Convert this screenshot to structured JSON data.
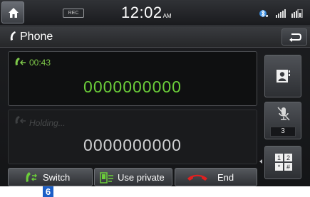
{
  "status_bar": {
    "home_icon": "home-icon",
    "rec_badge": "REC",
    "time": "12:02",
    "ampm": "AM",
    "icons": [
      "bluetooth-audio-icon",
      "signal-strength-icon",
      "battery-icon"
    ]
  },
  "title_bar": {
    "title": "Phone",
    "icon": "phone-icon",
    "back_icon": "back-arrow-icon"
  },
  "active_call": {
    "timer": "00:43",
    "number": "0000000000",
    "color": "#6ccf3a"
  },
  "held_call": {
    "status": "Holding...",
    "number": "0000000000"
  },
  "side_controls": {
    "contacts_icon": "contacts-icon",
    "mute_icon": "mic-mute-icon",
    "volume": "3",
    "keypad_icon": "keypad-icon",
    "keypad_keys": [
      "1",
      "2",
      "*",
      "#"
    ]
  },
  "actions": {
    "switch": "Switch",
    "use_private": "Use private",
    "end": "End"
  },
  "callout": "6",
  "colors": {
    "accent_green": "#6ccf3a",
    "end_red": "#e02020",
    "callout_blue": "#1b5fc7"
  }
}
